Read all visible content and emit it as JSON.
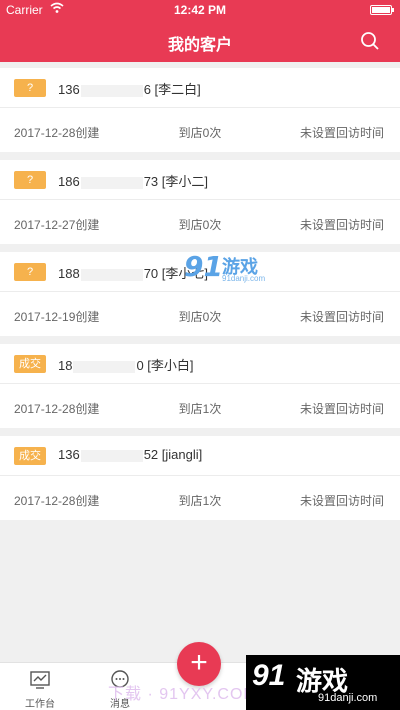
{
  "status_bar": {
    "carrier": "Carrier",
    "time": "12:42 PM"
  },
  "nav": {
    "title": "我的客户"
  },
  "customers": [
    {
      "badge": "?",
      "badge_type": "pending",
      "phone_prefix": "136",
      "phone_suffix": "6 [李二白]",
      "created": "2017-12-28创建",
      "visits": "到店0次",
      "followup": "未设置回访时间"
    },
    {
      "badge": "?",
      "badge_type": "pending",
      "phone_prefix": "186",
      "phone_suffix": "73 [李小二]",
      "created": "2017-12-27创建",
      "visits": "到店0次",
      "followup": "未设置回访时间"
    },
    {
      "badge": "?",
      "badge_type": "pending",
      "phone_prefix": "188",
      "phone_suffix": "70 [李小七]",
      "created": "2017-12-19创建",
      "visits": "到店0次",
      "followup": "未设置回访时间"
    },
    {
      "badge": "成交",
      "badge_type": "done",
      "phone_prefix": "18",
      "phone_suffix": "0 [李小白]",
      "created": "2017-12-28创建",
      "visits": "到店1次",
      "followup": "未设置回访时间"
    },
    {
      "badge": "成交",
      "badge_type": "done",
      "phone_prefix": "136",
      "phone_suffix": "52 [jiangli]",
      "created": "2017-12-28创建",
      "visits": "到店1次",
      "followup": "未设置回访时间"
    }
  ],
  "tabs": {
    "workbench": "工作台",
    "messages": "消息"
  },
  "fab": {
    "label": "+"
  },
  "watermarks": {
    "logo": "91",
    "brand": "游戏",
    "site": "91danji.com",
    "overlay": "下载 · 91YXY.COM"
  },
  "colors": {
    "primary": "#e83a54",
    "badge": "#f6b24d"
  },
  "icons": {
    "search": "search-icon",
    "wifi": "wifi-icon",
    "battery": "battery-icon",
    "workbench": "chart-icon",
    "messages": "chat-bubble-icon"
  }
}
